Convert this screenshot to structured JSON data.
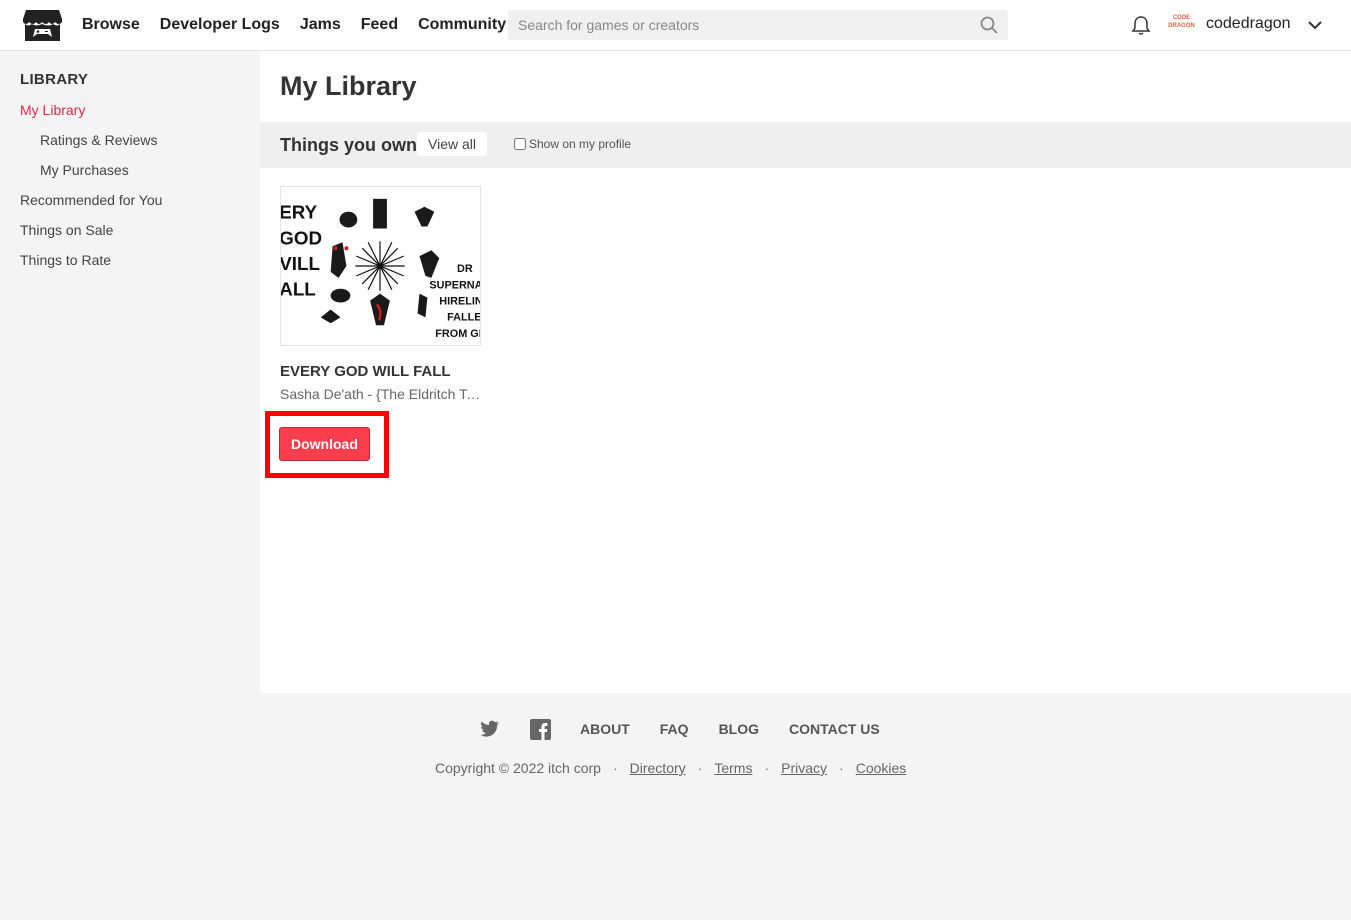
{
  "header": {
    "nav": [
      "Browse",
      "Developer Logs",
      "Jams",
      "Feed",
      "Community"
    ],
    "search_placeholder": "Search for games or creators",
    "avatar_text": "CODE DRAGON",
    "username": "codedragon"
  },
  "sidebar": {
    "heading": "LIBRARY",
    "items": [
      {
        "label": "My Library",
        "active": true
      },
      {
        "label": "Ratings & Reviews"
      },
      {
        "label": "My Purchases"
      },
      {
        "label": "Recommended for You"
      },
      {
        "label": "Things on Sale"
      },
      {
        "label": "Things to Rate"
      }
    ]
  },
  "main": {
    "title": "My Library",
    "section_title": "Things you own",
    "view_all": "View all",
    "show_profile": "Show on my profile",
    "game": {
      "title": "EVERY GOD WILL FALL",
      "author": "Sasha De'ath - {The Eldritch Tome}",
      "download": "Download",
      "cover_left": [
        "ERY",
        "GOD",
        "VILL",
        "ALL"
      ],
      "cover_right": [
        "DR",
        "SUPERNATU",
        "HIRELING",
        "FALLEN",
        "FROM GRA"
      ]
    }
  },
  "footer": {
    "links": [
      "ABOUT",
      "FAQ",
      "BLOG",
      "CONTACT US"
    ],
    "copyright": "Copyright © 2022 itch corp",
    "legal": [
      "Directory",
      "Terms",
      "Privacy",
      "Cookies"
    ]
  },
  "colors": {
    "accent": "#fa3e4e",
    "active_link": "#da2c49",
    "highlight": "#ff0000"
  }
}
